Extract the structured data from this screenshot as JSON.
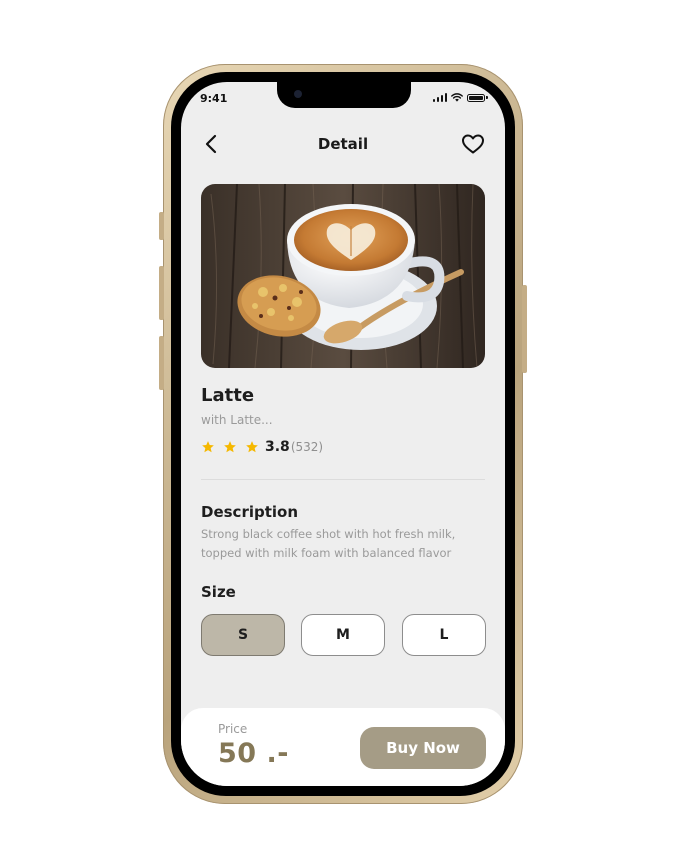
{
  "status_bar": {
    "time": "9:41"
  },
  "header": {
    "title": "Detail"
  },
  "product": {
    "name": "Latte",
    "subtitle": "with Latte...",
    "rating": "3.8",
    "review_count": "(532)",
    "stars_shown": 3
  },
  "description": {
    "title": "Description",
    "text": "Strong black coffee shot with hot fresh milk, topped with milk foam with balanced flavor"
  },
  "size": {
    "title": "Size",
    "options": [
      "S",
      "M",
      "L"
    ],
    "selected": "S"
  },
  "footer": {
    "price_label": "Price",
    "price_value": "50 .-",
    "buy_label": "Buy Now"
  },
  "colors": {
    "accent": "#a59c86",
    "price": "#857857",
    "star": "#f5b800",
    "selected_size": "#bdb7a8",
    "frame_gold": "#c8b48f"
  },
  "icons": {
    "back": "chevron-left-icon",
    "favorite": "heart-icon",
    "star": "star-icon"
  }
}
